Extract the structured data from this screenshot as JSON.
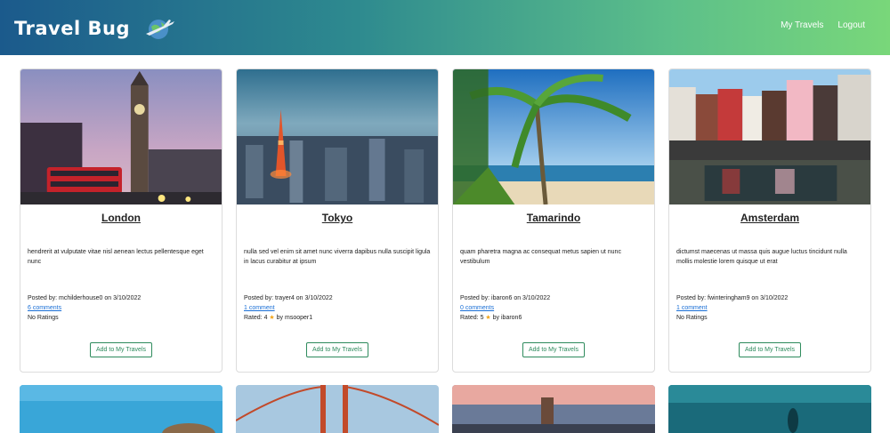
{
  "navbar": {
    "brand": "Travel Bug",
    "links": [
      {
        "label": "My Travels"
      },
      {
        "label": "Logout"
      }
    ]
  },
  "cards": [
    {
      "title": "London",
      "description": "hendrerit at vulputate vitae nisl aenean lectus pellentesque eget nunc",
      "posted_by": "Posted by: mchilderhouse0 on 3/10/2022",
      "comments": "6 comments",
      "rating_text": "No Ratings",
      "rating_value": null,
      "rated_by": "",
      "button": "Add to My Travels"
    },
    {
      "title": "Tokyo",
      "description": "nulla sed vel enim sit amet nunc viverra dapibus nulla suscipit ligula in lacus curabitur at ipsum",
      "posted_by": "Posted by: trayer4 on 3/10/2022",
      "comments": "1 comment",
      "rating_text": "Rated: 4",
      "rating_value": 4,
      "rated_by": "by msooper1",
      "button": "Add to My Travels"
    },
    {
      "title": "Tamarindo",
      "description": "quam pharetra magna ac consequat metus sapien ut nunc vestibulum",
      "posted_by": "Posted by: ibaron6 on 3/10/2022",
      "comments": "0 comments",
      "rating_text": "Rated: 5",
      "rating_value": 5,
      "rated_by": "by ibaron6",
      "button": "Add to My Travels"
    },
    {
      "title": "Amsterdam",
      "description": "dictumst maecenas ut massa quis augue luctus tincidunt nulla mollis molestie lorem quisque ut erat",
      "posted_by": "Posted by: fwinteringham9 on 3/10/2022",
      "comments": "1 comment",
      "rating_text": "No Ratings",
      "rating_value": null,
      "rated_by": "",
      "button": "Add to My Travels"
    }
  ],
  "colors": {
    "nav_gradient_start": "#1b5a8c",
    "nav_gradient_end": "#79d77a",
    "button_accent": "#2d8a5c",
    "link": "#1a6fd6",
    "star": "#f2a51a"
  },
  "icons": {
    "brand_logo": "globe-airplane-icon",
    "rating": "star-icon"
  }
}
